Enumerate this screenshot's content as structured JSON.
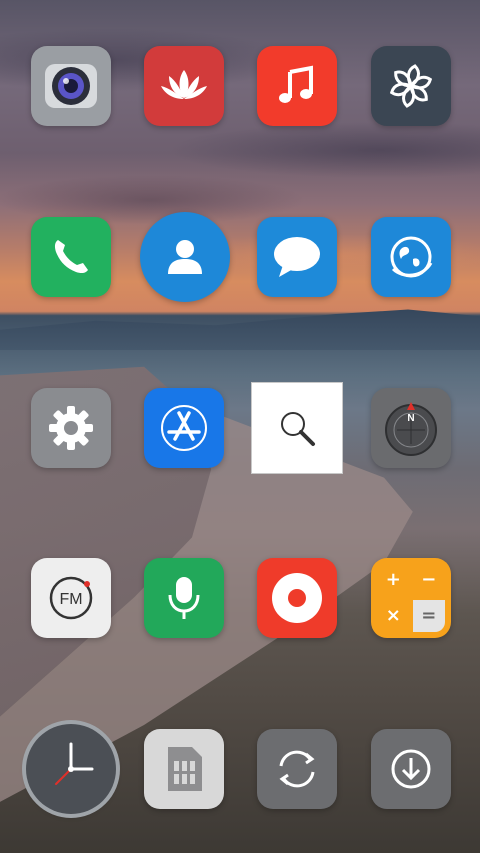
{
  "screen": {
    "type": "android-home-screen",
    "wallpaper": "sunset-boardwalk",
    "colors": {
      "camera_bg": "#9a9ea3",
      "gallery_bg": "#d23b3b",
      "music_bg": "#f23b2b",
      "pinwheel_bg": "#3b4653",
      "phone_bg": "#22b15f",
      "contacts_bg": "#1e88d8",
      "messages_bg": "#1e8ad9",
      "browser_bg": "#1e88d8",
      "settings_bg": "#8a8c90",
      "appstore_bg": "#1877e8",
      "search_bg": "#ffffff",
      "compass_bg": "#6a6b6e",
      "fm_bg": "#eeeeee",
      "recorder_bg": "#22a85a",
      "record_bg": "#ef3b2a",
      "calculator_bg": "#f7a21b",
      "clock_bg": "#4b4f55",
      "sim_bg": "#d8d8d8",
      "sync_bg": "#6c6d70",
      "download_bg": "#6c6d70"
    }
  },
  "apps": [
    {
      "id": "camera",
      "icon": "camera-lens-icon"
    },
    {
      "id": "gallery",
      "icon": "lotus-icon"
    },
    {
      "id": "music",
      "icon": "music-note-icon"
    },
    {
      "id": "pinwheel",
      "icon": "pinwheel-icon"
    },
    {
      "id": "phone",
      "icon": "phone-handset-icon"
    },
    {
      "id": "contacts",
      "icon": "person-icon"
    },
    {
      "id": "messages",
      "icon": "speech-bubble-icon"
    },
    {
      "id": "browser",
      "icon": "globe-icon"
    },
    {
      "id": "settings",
      "icon": "gear-icon"
    },
    {
      "id": "app-store",
      "icon": "app-store-icon"
    },
    {
      "id": "search",
      "icon": "magnifier-icon"
    },
    {
      "id": "compass",
      "icon": "compass-icon"
    },
    {
      "id": "fm-radio",
      "icon": "fm-radio-icon",
      "text": "FM"
    },
    {
      "id": "voice-recorder",
      "icon": "microphone-icon"
    },
    {
      "id": "recorder",
      "icon": "record-icon"
    },
    {
      "id": "calculator",
      "icon": "calculator-icon",
      "symbols": [
        "+",
        "−",
        "×",
        "="
      ]
    },
    {
      "id": "clock",
      "icon": "clock-icon"
    },
    {
      "id": "sim-toolkit",
      "icon": "sim-card-icon"
    },
    {
      "id": "sync",
      "icon": "sync-icon"
    },
    {
      "id": "downloads",
      "icon": "download-icon"
    }
  ],
  "compass_letter": "N"
}
